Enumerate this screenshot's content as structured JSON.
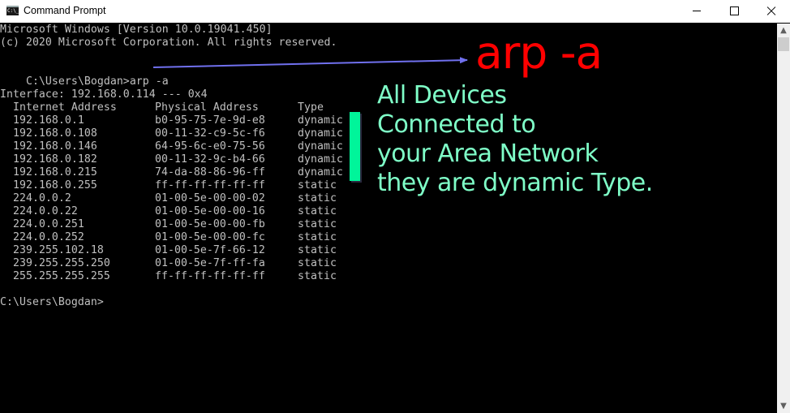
{
  "window": {
    "title": "Command Prompt",
    "icon": "console-icon",
    "icon_text": "C:\\_",
    "controls": {
      "minimize": "minimize-icon",
      "maximize": "maximize-icon",
      "close": "close-icon"
    }
  },
  "console": {
    "header_lines": [
      "Microsoft Windows [Version 10.0.19041.450]",
      "(c) 2020 Microsoft Corporation. All rights reserved."
    ],
    "prompt": "C:\\Users\\Bogdan>",
    "command": "arp -a",
    "interface_line": "Interface: 192.168.0.114 --- 0x4",
    "table_headers": [
      "Internet Address",
      "Physical Address",
      "Type"
    ],
    "arp_entries": [
      {
        "ip": "192.168.0.1",
        "mac": "b0-95-75-7e-9d-e8",
        "type": "dynamic"
      },
      {
        "ip": "192.168.0.108",
        "mac": "00-11-32-c9-5c-f6",
        "type": "dynamic"
      },
      {
        "ip": "192.168.0.146",
        "mac": "64-95-6c-e0-75-56",
        "type": "dynamic"
      },
      {
        "ip": "192.168.0.182",
        "mac": "00-11-32-9c-b4-66",
        "type": "dynamic"
      },
      {
        "ip": "192.168.0.215",
        "mac": "74-da-88-86-96-ff",
        "type": "dynamic"
      },
      {
        "ip": "192.168.0.255",
        "mac": "ff-ff-ff-ff-ff-ff",
        "type": "static"
      },
      {
        "ip": "224.0.0.2",
        "mac": "01-00-5e-00-00-02",
        "type": "static"
      },
      {
        "ip": "224.0.0.22",
        "mac": "01-00-5e-00-00-16",
        "type": "static"
      },
      {
        "ip": "224.0.0.251",
        "mac": "01-00-5e-00-00-fb",
        "type": "static"
      },
      {
        "ip": "224.0.0.252",
        "mac": "01-00-5e-00-00-fc",
        "type": "static"
      },
      {
        "ip": "239.255.102.18",
        "mac": "01-00-5e-7f-66-12",
        "type": "static"
      },
      {
        "ip": "239.255.255.250",
        "mac": "01-00-5e-7f-ff-fa",
        "type": "static"
      },
      {
        "ip": "255.255.255.255",
        "mac": "ff-ff-ff-ff-ff-ff",
        "type": "static"
      }
    ],
    "final_prompt": "C:\\Users\\Bogdan>"
  },
  "annotations": {
    "command_label": "arp -a",
    "note_lines": [
      "All Devices",
      "Connected to",
      "your Area Network",
      "they are dynamic Type."
    ],
    "colors": {
      "command_label": "#ff0000",
      "note": "#7fffc8",
      "highlight_bar": "#00f59a",
      "arrow": "#7070ee"
    }
  },
  "scrollbar": {
    "up": "▲",
    "down": "▼"
  }
}
